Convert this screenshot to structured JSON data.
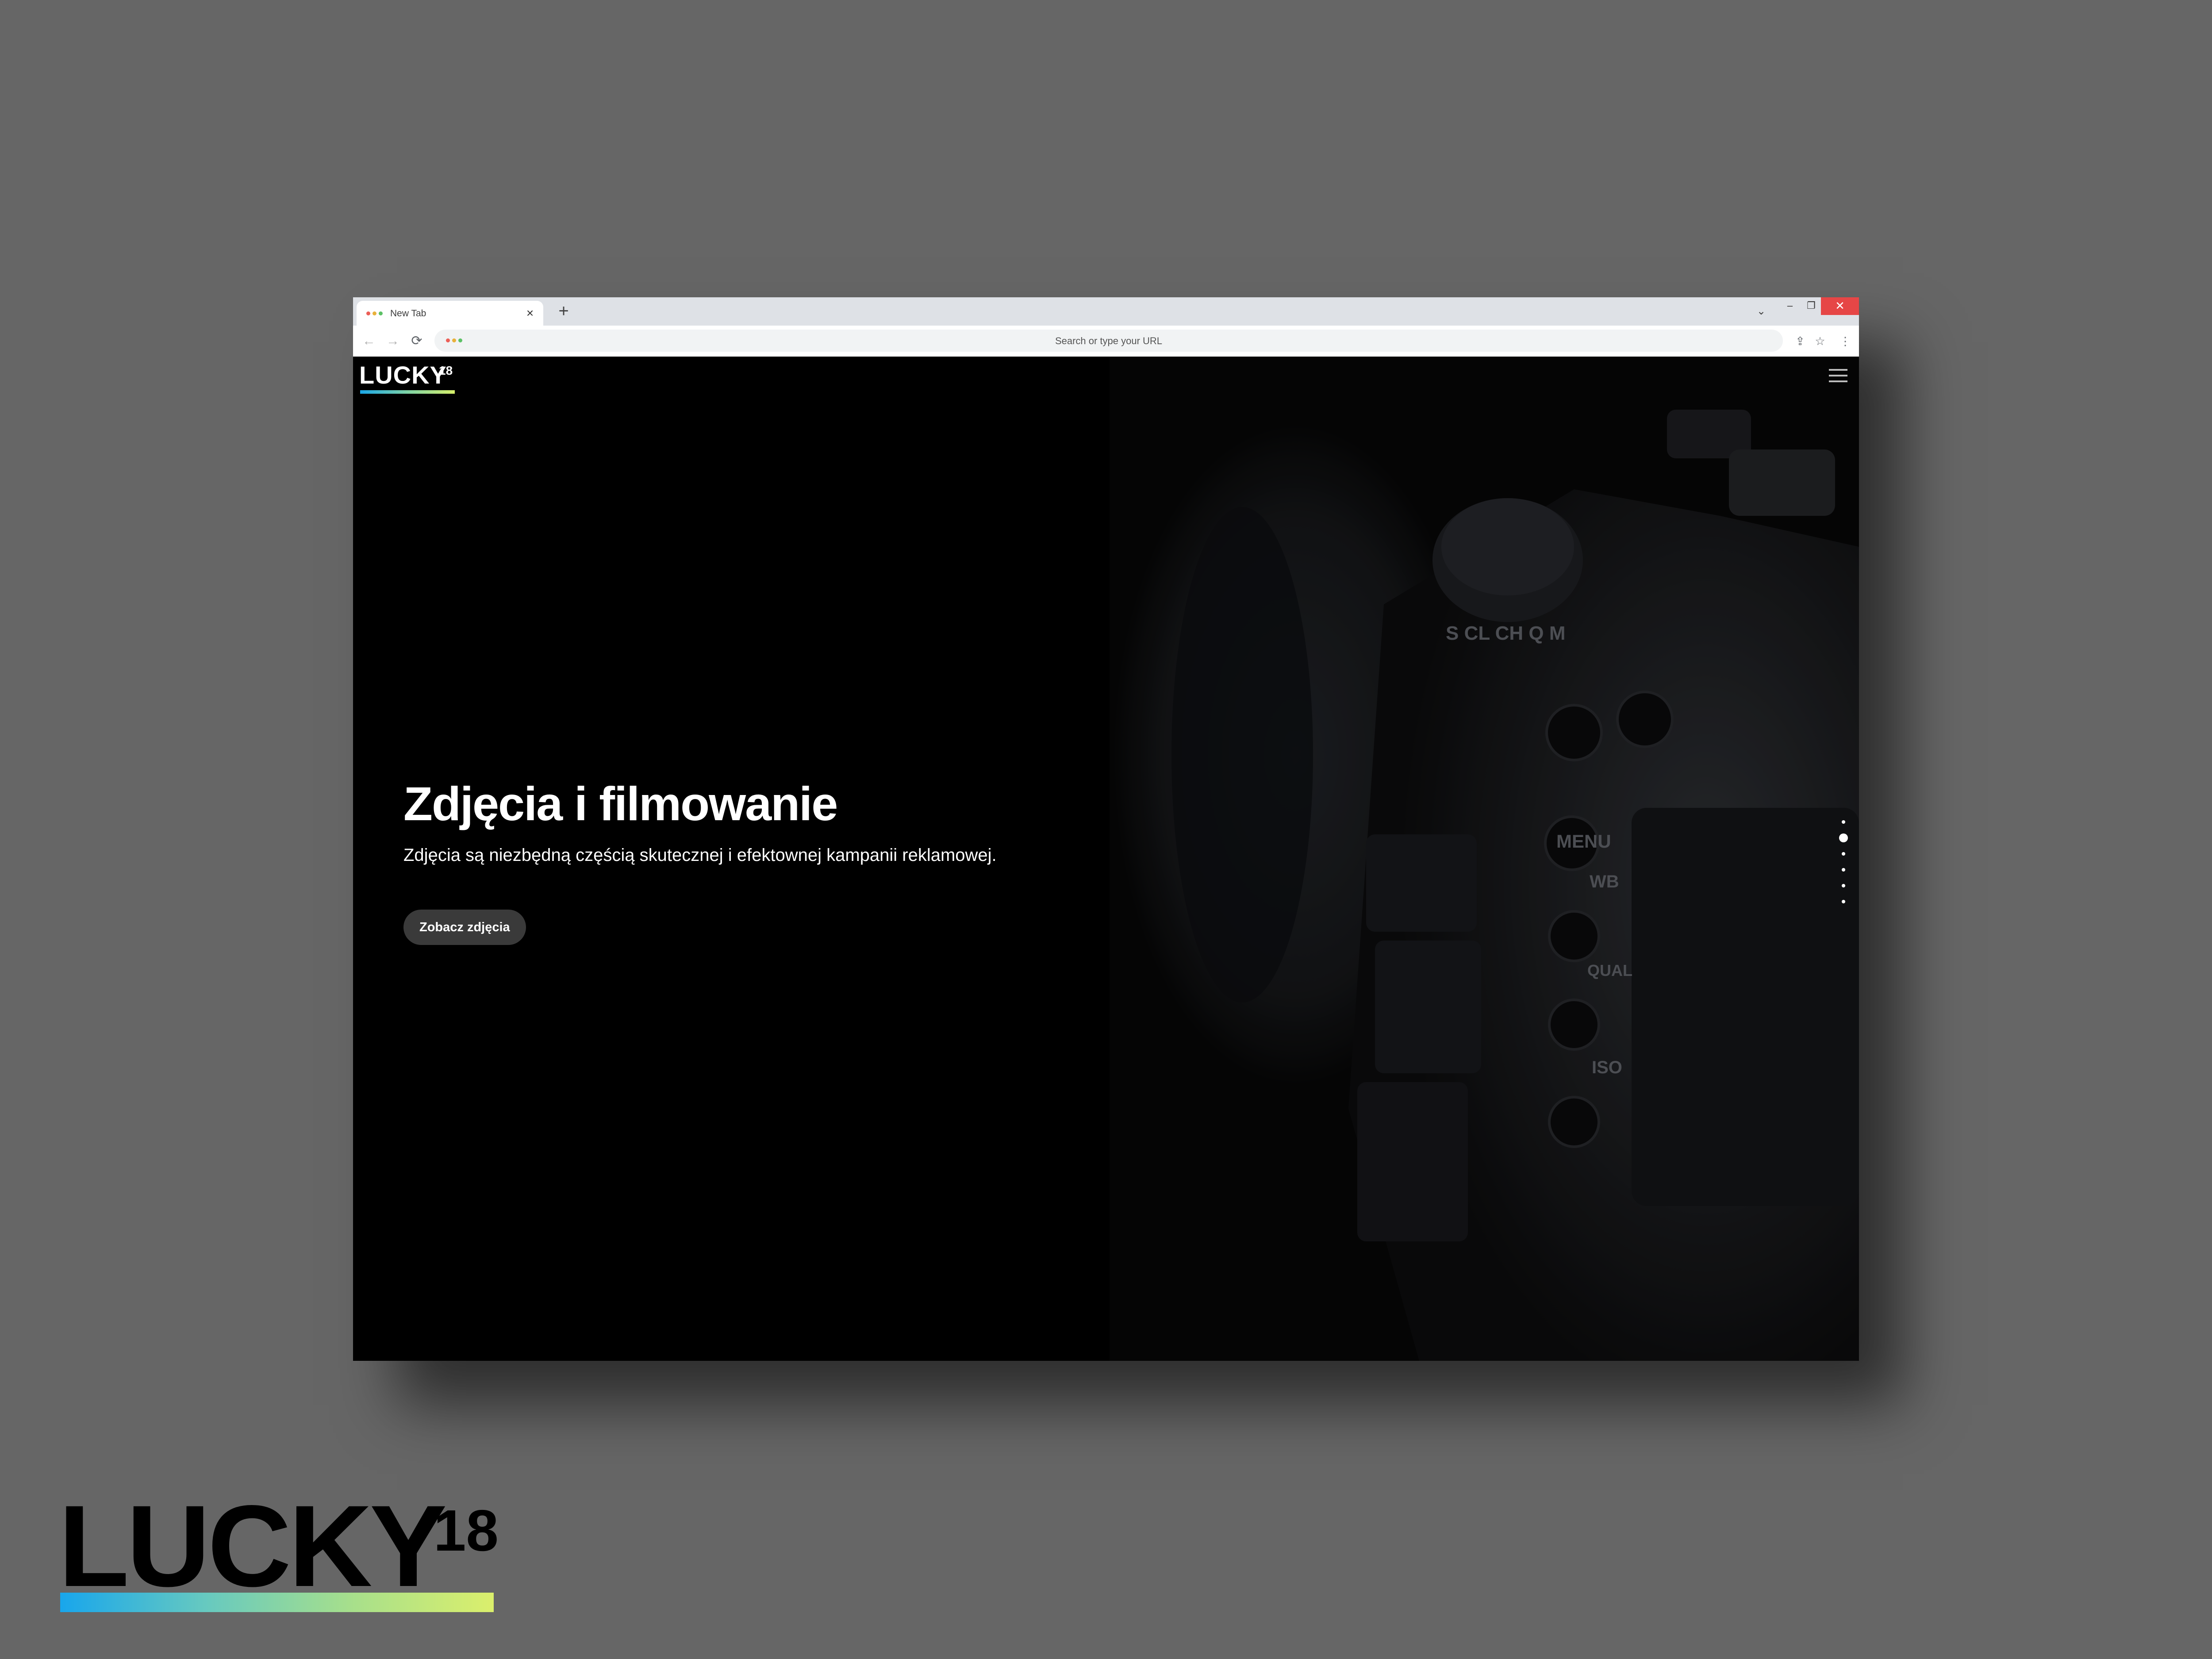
{
  "browser": {
    "tab": {
      "title": "New Tab",
      "close_glyph": "×"
    },
    "new_tab_glyph": "+",
    "tab_search_glyph": "⌄",
    "window": {
      "minimize": "–",
      "maximize": "❐",
      "close": "✕"
    },
    "nav": {
      "back": "←",
      "forward": "→",
      "reload": "⟳"
    },
    "omnibox": {
      "placeholder": "Search or type your URL"
    },
    "toolbar_icons": [
      "share-icon",
      "star-icon",
      "extensions-icon",
      "side-panel-icon",
      "profile-icon",
      "kebab-menu-icon"
    ],
    "icon_glyphs": {
      "share": "⇪",
      "star": "☆",
      "extensions": "✦",
      "side_panel": "▣",
      "profile": "●",
      "menu": "⋮"
    },
    "colors": {
      "dot_red": "#ec5f57",
      "dot_yellow": "#e8b13b",
      "dot_green": "#5cc166",
      "close_red": "#e64646"
    }
  },
  "site": {
    "logo": {
      "text": "LUCKY",
      "superscript": "18"
    },
    "hero": {
      "title": "Zdjęcia i filmowanie",
      "subtitle": "Zdjęcia są niezbędną częścią skutecznej i efektownej kampanii reklamowej.",
      "cta_label": "Zobacz zdjęcia"
    },
    "slider": {
      "total": 6,
      "active_index": 1
    },
    "camera_labels": [
      "MENU",
      "WB",
      "QUAL",
      "ISO",
      "S",
      "CL",
      "CH",
      "Q",
      "M"
    ],
    "menu_icon": "hamburger-menu-icon"
  },
  "brand": {
    "text": "LUCKY",
    "superscript": "18",
    "accent_gradient": [
      "#18a6ec",
      "#a6df8c",
      "#dbef6c"
    ]
  }
}
